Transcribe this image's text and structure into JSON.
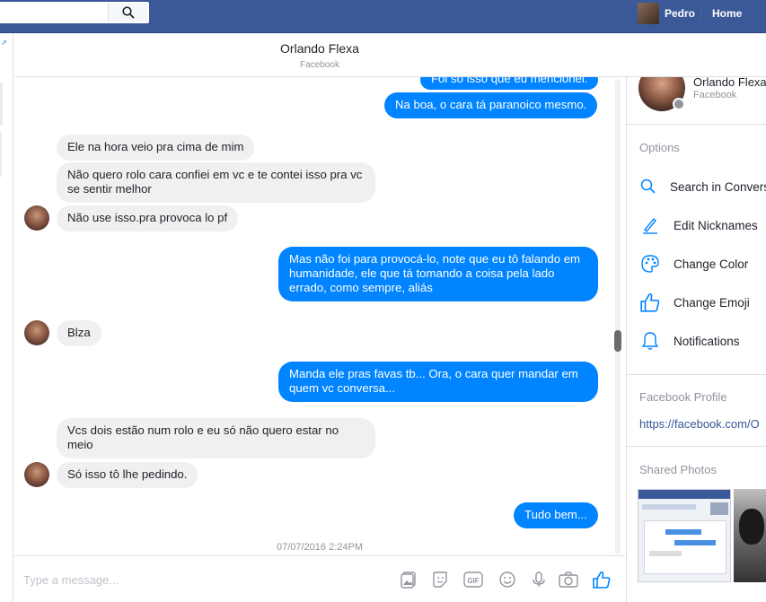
{
  "topbar": {
    "user_name": "Pedro",
    "home_label": "Home"
  },
  "conversation": {
    "title": "Orlando Flexa",
    "subtitle": "Facebook"
  },
  "messages": [
    {
      "dir": "out",
      "text": "Foi só isso que eu mencionei."
    },
    {
      "dir": "out",
      "text": "Na boa, o cara tá paranoico mesmo."
    },
    {
      "dir": "in",
      "text": "Ele na hora veio pra cima de mim"
    },
    {
      "dir": "in",
      "text": "Não quero rolo cara confiei em vc e te contei isso pra vc se sentir melhor"
    },
    {
      "dir": "in",
      "text": "Não use isso.pra provoca lo pf"
    },
    {
      "dir": "out",
      "text": "Mas não foi para provocá-lo, note que eu tô falando em humanidade, ele que tá tomando a coisa pela lado errado, como sempre, aliás"
    },
    {
      "dir": "in",
      "text": "Blza"
    },
    {
      "dir": "out",
      "text": "Manda ele pras favas tb... Ora, o cara quer mandar em quem vc conversa..."
    },
    {
      "dir": "in",
      "text": "Vcs dois estão num rolo e eu só não quero estar no meio"
    },
    {
      "dir": "in",
      "text": "Só isso tô lhe pedindo."
    },
    {
      "dir": "out",
      "text": "Tudo bem..."
    }
  ],
  "timestamp": "07/07/2016 2:24PM",
  "composer": {
    "placeholder": "Type a message..."
  },
  "sidebar": {
    "name": "Orlando Flexa",
    "sub": "Facebook",
    "options_heading": "Options",
    "options": [
      {
        "label": "Search in Conversation",
        "icon": "search-icon"
      },
      {
        "label": "Edit Nicknames",
        "icon": "pencil-icon"
      },
      {
        "label": "Change Color",
        "icon": "palette-icon"
      },
      {
        "label": "Change Emoji",
        "icon": "thumbs-up-icon"
      },
      {
        "label": "Notifications",
        "icon": "bell-icon"
      }
    ],
    "profile_heading": "Facebook Profile",
    "profile_link": "https://facebook.com/O",
    "photos_heading": "Shared Photos"
  },
  "colors": {
    "brand": "#3b5998",
    "accent": "#0084ff",
    "incoming": "#f1f0f0"
  }
}
